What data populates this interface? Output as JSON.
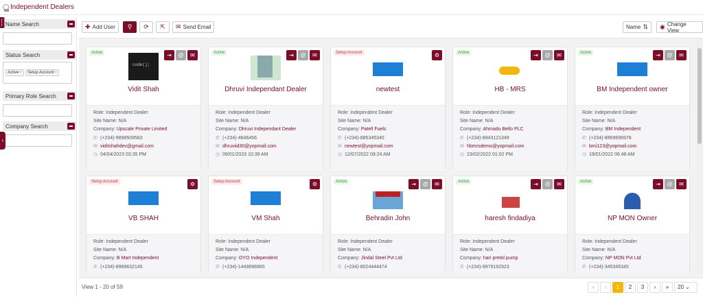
{
  "header": {
    "title": "Independent Dealers"
  },
  "sidebar": {
    "sections": [
      {
        "title": "Name Search",
        "value": ""
      },
      {
        "title": "Status Search",
        "chips": [
          "Active",
          "Setup Account"
        ]
      },
      {
        "title": "Primary Role Search",
        "value": ""
      },
      {
        "title": "Company Search",
        "value": ""
      }
    ]
  },
  "toolbar": {
    "add_user": "Add User",
    "send_email": "Send Email",
    "sort_label": "Name",
    "change_view": "Change View"
  },
  "cards": [
    {
      "status": "Active",
      "name": "Vidit Shah",
      "role": "Role: Independent Dealer",
      "site": "Site Name: N/A",
      "company_prefix": "Company:",
      "company": "Upscale Private Limited",
      "phone": "(+234)-9898509583",
      "email": "viditshahdev@gmail.com",
      "date": "04/04/2023 03:35 PM",
      "thumb": "code();"
    },
    {
      "status": "Active",
      "name": "Dhruvi Independant Dealer",
      "role": "Role: Independent Dealer",
      "site": "Site Name: N/A",
      "company_prefix": "Company:",
      "company": "Dhruvi Independant Dealer",
      "phone": "(+234)-4646456",
      "email": "dhruviid30@yopmail.com",
      "date": "09/01/2023 10:39 AM",
      "thumb": ""
    },
    {
      "status": "Setup Account",
      "name": "newtest",
      "role": "Role: Independent Dealer",
      "site": "Site Name: N/A",
      "company_prefix": "Company:",
      "company": "Patell Fuels",
      "phone": "(+234)-885345345",
      "email": "newtest@yopmail.com",
      "date": "12/07/2022 08:24 AM",
      "thumb": ""
    },
    {
      "status": "Active",
      "name": "HB - MRS",
      "role": "Role: Independent Dealer",
      "site": "Site Name: N/A",
      "company_prefix": "Company:",
      "company": "Ahmadu Bello PLC",
      "phone": "(+234)-8943121349",
      "email": "hbmrsdemo@yopmail.com",
      "date": "23/02/2022 01:02 PM",
      "thumb": ""
    },
    {
      "status": "Active",
      "name": "BM Independent owner",
      "role": "Role: Independent Dealer",
      "site": "Site Name: N/A",
      "company_prefix": "Company:",
      "company": "BM Independent",
      "phone": "(+234)-8969696978",
      "email": "bmi123@yopmail.com",
      "date": "19/01/2022 06:48 AM",
      "thumb": ""
    },
    {
      "status": "Setup Account",
      "name": "VB SHAH",
      "role": "Role: Independent Dealer",
      "site": "Site Name: N/A",
      "company_prefix": "Company:",
      "company": "B Mart Independent",
      "phone": "(+234)-8969632145",
      "email": "",
      "date": "",
      "thumb": ""
    },
    {
      "status": "Setup Account",
      "name": "VM Shah",
      "role": "Role: Independent Dealer",
      "site": "Site Name: N/A",
      "company_prefix": "Company:",
      "company": "OYO Independent",
      "phone": "(+234)-1449696965",
      "email": "",
      "date": "",
      "thumb": ""
    },
    {
      "status": "Active",
      "name": "Behradin John",
      "role": "Role: Independent Dealer",
      "site": "Site Name: N/A",
      "company_prefix": "Company:",
      "company": "Jindal Steel Pvt Ltd",
      "phone": "(+234)-8024444474",
      "email": "",
      "date": "",
      "thumb": ""
    },
    {
      "status": "Active",
      "name": "haresh findadiya",
      "role": "Role: Independent Dealer",
      "site": "Site Name: N/A",
      "company_prefix": "Company:",
      "company": "hari pretol pump",
      "phone": "(+234)-9979192923",
      "email": "",
      "date": "",
      "thumb": ""
    },
    {
      "status": "Active",
      "name": "NP MON Owner",
      "role": "Role: Independent Dealer",
      "site": "Site Name: N/A",
      "company_prefix": "Company:",
      "company": "NP MON Pvt Ltd",
      "phone": "(+234)-345345345",
      "email": "",
      "date": "",
      "thumb": ""
    }
  ],
  "footer": {
    "view_text": "View 1 - 20 of 59",
    "pages": [
      "1",
      "2",
      "3"
    ],
    "per_page": "20"
  },
  "colors": {
    "brand": "#7a0d2a",
    "current_page": "#f1b70f"
  }
}
